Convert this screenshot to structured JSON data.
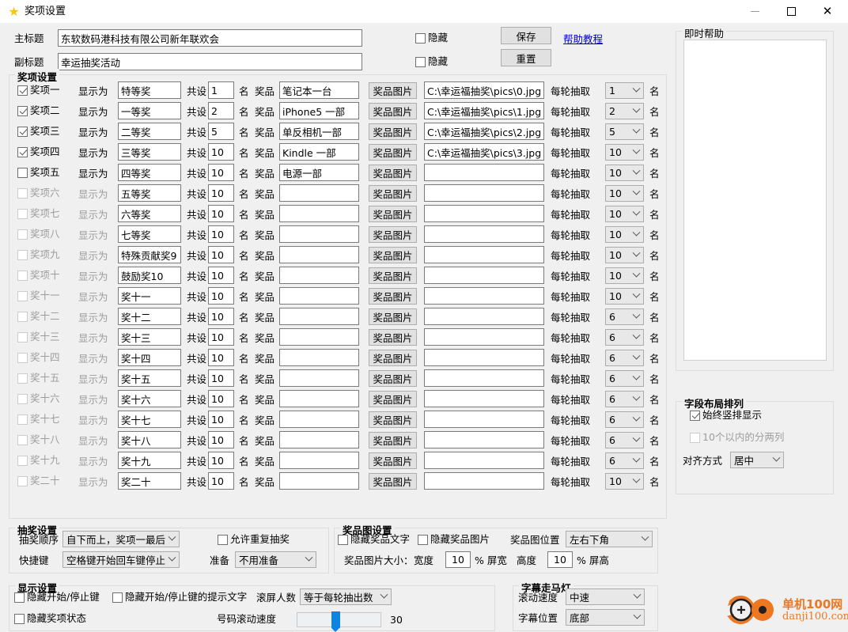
{
  "window": {
    "title": "奖项设置",
    "icon": "star-icon",
    "minimize": "—",
    "maximize": "□",
    "close": "✕"
  },
  "header": {
    "main_title_label": "主标题",
    "main_title_value": "东软数码港科技有限公司新年联欢会",
    "sub_title_label": "副标题",
    "sub_title_value": "幸运抽奖活动",
    "hide1_label": "隐藏",
    "hide1_checked": false,
    "hide2_label": "隐藏",
    "hide2_checked": false,
    "save_label": "保存",
    "reset_label": "重置",
    "help_link": "帮助教程"
  },
  "prize_group": {
    "title": "奖项设置",
    "col_show_as": "显示为",
    "col_total": "共设",
    "col_unit": "名",
    "col_prize": "奖品",
    "col_image_btn": "奖品图片",
    "col_per_round": "每轮抽取",
    "col_per_round_unit": "名",
    "rows": [
      {
        "checkbox_label": "奖项一",
        "checked": true,
        "enabled": true,
        "display_name": "特等奖",
        "total": "1",
        "prize": "笔记本一台",
        "image_path": "C:\\幸运福抽奖\\pics\\0.jpg",
        "per_round": "1"
      },
      {
        "checkbox_label": "奖项二",
        "checked": true,
        "enabled": true,
        "display_name": "一等奖",
        "total": "2",
        "prize": "iPhone5 一部",
        "image_path": "C:\\幸运福抽奖\\pics\\1.jpg",
        "per_round": "2"
      },
      {
        "checkbox_label": "奖项三",
        "checked": true,
        "enabled": true,
        "display_name": "二等奖",
        "total": "5",
        "prize": "单反相机一部",
        "image_path": "C:\\幸运福抽奖\\pics\\2.jpg",
        "per_round": "5"
      },
      {
        "checkbox_label": "奖项四",
        "checked": true,
        "enabled": true,
        "display_name": "三等奖",
        "total": "10",
        "prize": "Kindle 一部",
        "image_path": "C:\\幸运福抽奖\\pics\\3.jpg",
        "per_round": "10"
      },
      {
        "checkbox_label": "奖项五",
        "checked": false,
        "enabled": true,
        "display_name": "四等奖",
        "total": "10",
        "prize": "电源一部",
        "image_path": "",
        "per_round": "10"
      },
      {
        "checkbox_label": "奖项六",
        "checked": false,
        "enabled": false,
        "display_name": "五等奖",
        "total": "10",
        "prize": "",
        "image_path": "",
        "per_round": "10"
      },
      {
        "checkbox_label": "奖项七",
        "checked": false,
        "enabled": false,
        "display_name": "六等奖",
        "total": "10",
        "prize": "",
        "image_path": "",
        "per_round": "10"
      },
      {
        "checkbox_label": "奖项八",
        "checked": false,
        "enabled": false,
        "display_name": "七等奖",
        "total": "10",
        "prize": "",
        "image_path": "",
        "per_round": "10"
      },
      {
        "checkbox_label": "奖项九",
        "checked": false,
        "enabled": false,
        "display_name": "特殊贡献奖9",
        "total": "10",
        "prize": "",
        "image_path": "",
        "per_round": "10"
      },
      {
        "checkbox_label": "奖项十",
        "checked": false,
        "enabled": false,
        "display_name": "鼓励奖10",
        "total": "10",
        "prize": "",
        "image_path": "",
        "per_round": "10"
      },
      {
        "checkbox_label": "奖十一",
        "checked": false,
        "enabled": false,
        "display_name": "奖十一",
        "total": "10",
        "prize": "",
        "image_path": "",
        "per_round": "10"
      },
      {
        "checkbox_label": "奖十二",
        "checked": false,
        "enabled": false,
        "display_name": "奖十二",
        "total": "10",
        "prize": "",
        "image_path": "",
        "per_round": "6"
      },
      {
        "checkbox_label": "奖十三",
        "checked": false,
        "enabled": false,
        "display_name": "奖十三",
        "total": "10",
        "prize": "",
        "image_path": "",
        "per_round": "6"
      },
      {
        "checkbox_label": "奖十四",
        "checked": false,
        "enabled": false,
        "display_name": "奖十四",
        "total": "10",
        "prize": "",
        "image_path": "",
        "per_round": "6"
      },
      {
        "checkbox_label": "奖十五",
        "checked": false,
        "enabled": false,
        "display_name": "奖十五",
        "total": "10",
        "prize": "",
        "image_path": "",
        "per_round": "6"
      },
      {
        "checkbox_label": "奖十六",
        "checked": false,
        "enabled": false,
        "display_name": "奖十六",
        "total": "10",
        "prize": "",
        "image_path": "",
        "per_round": "6"
      },
      {
        "checkbox_label": "奖十七",
        "checked": false,
        "enabled": false,
        "display_name": "奖十七",
        "total": "10",
        "prize": "",
        "image_path": "",
        "per_round": "6"
      },
      {
        "checkbox_label": "奖十八",
        "checked": false,
        "enabled": false,
        "display_name": "奖十八",
        "total": "10",
        "prize": "",
        "image_path": "",
        "per_round": "6"
      },
      {
        "checkbox_label": "奖十九",
        "checked": false,
        "enabled": false,
        "display_name": "奖十九",
        "total": "10",
        "prize": "",
        "image_path": "",
        "per_round": "6"
      },
      {
        "checkbox_label": "奖二十",
        "checked": false,
        "enabled": false,
        "display_name": "奖二十",
        "total": "10",
        "prize": "",
        "image_path": "",
        "per_round": "10"
      }
    ]
  },
  "draw_settings": {
    "title": "抽奖设置",
    "order_label": "抽奖顺序",
    "order_value": "自下而上，奖项一最后",
    "hotkey_label": "快捷键",
    "hotkey_value": "空格键开始回车键停止",
    "allow_repeat_label": "允许重复抽奖",
    "allow_repeat_checked": false,
    "prepare_label": "准备",
    "prepare_value": "不用准备"
  },
  "prize_image_settings": {
    "title": "奖品图设置",
    "hide_text_label": "隐藏奖品文字",
    "hide_text_checked": false,
    "hide_image_label": "隐藏奖品图片",
    "hide_image_checked": false,
    "position_label": "奖品图位置",
    "position_value": "左右下角",
    "size_label": "奖品图片大小：",
    "width_label": "宽度",
    "width_value": "10",
    "width_unit": "% 屏宽",
    "height_label": "高度",
    "height_value": "10",
    "height_unit": "% 屏高"
  },
  "display_settings": {
    "title": "显示设置",
    "hide_startstop_label": "隐藏开始/停止键",
    "hide_startstop_checked": false,
    "hide_hint_label": "隐藏开始/停止键的提示文字",
    "hide_hint_checked": false,
    "hide_status_label": "隐藏奖项状态",
    "hide_status_checked": false,
    "scroll_count_label": "滚屏人数",
    "scroll_count_value": "等于每轮抽出数",
    "number_speed_label": "号码滚动速度",
    "number_speed_value": "30"
  },
  "marquee_settings": {
    "title": "字幕走马灯",
    "speed_label": "滚动速度",
    "speed_value": "中速",
    "position_label": "字幕位置",
    "position_value": "底部"
  },
  "instant_help": {
    "title": "即时帮助",
    "content": ""
  },
  "layout_settings": {
    "title": "字段布局排列",
    "always_vertical_label": "始终竖排显示",
    "always_vertical_checked": true,
    "two_columns_label": "10个以内的分两列",
    "two_columns_checked": false,
    "two_columns_enabled": false,
    "align_label": "对齐方式",
    "align_value": "居中"
  },
  "watermark": {
    "name": "单机100网",
    "domain": "danji100.com",
    "color": "#ee7722"
  }
}
